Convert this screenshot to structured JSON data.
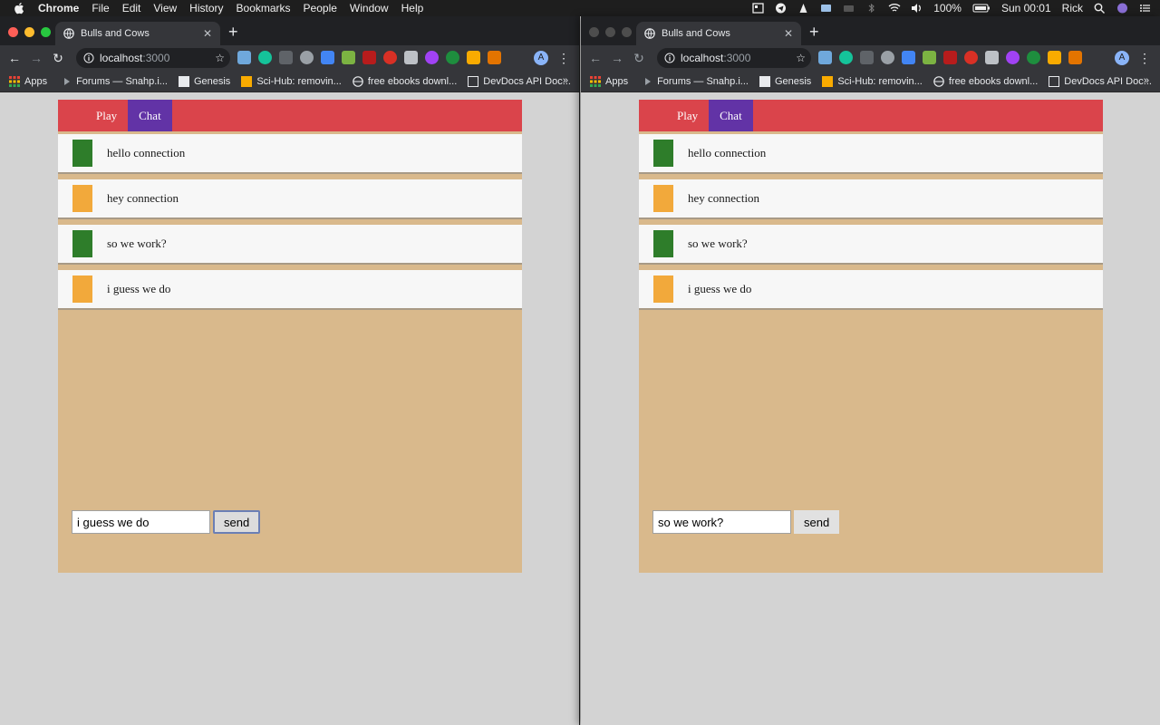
{
  "menubar": {
    "app_name": "Chrome",
    "items": [
      "File",
      "Edit",
      "View",
      "History",
      "Bookmarks",
      "People",
      "Window",
      "Help"
    ],
    "battery": "100%",
    "clock": "Sun 00:01",
    "user": "Rick"
  },
  "left": {
    "tab_title": "Bulls and Cows",
    "url_host": "localhost",
    "url_port": ":3000",
    "avatar_letter": "A",
    "bookmarks": {
      "apps": "Apps",
      "b1": "Forums — Snahp.i...",
      "b2": "Genesis",
      "b3": "Sci-Hub: removin...",
      "b4": "free ebooks downl...",
      "b5": "DevDocs API Doc..."
    },
    "nav": {
      "play": "Play",
      "chat": "Chat"
    },
    "messages": [
      {
        "text": "hello connection",
        "color": "#2e7d2a"
      },
      {
        "text": "hey connection",
        "color": "#f2a93b"
      },
      {
        "text": "so we work?",
        "color": "#2e7d2a"
      },
      {
        "text": "i guess we do",
        "color": "#f2a93b"
      }
    ],
    "input_value": "i guess we do",
    "send_label": "send"
  },
  "right": {
    "tab_title": "Bulls and Cows",
    "url_host": "localhost",
    "url_port": ":3000",
    "avatar_letter": "A",
    "bookmarks": {
      "apps": "Apps",
      "b1": "Forums — Snahp.i...",
      "b2": "Genesis",
      "b3": "Sci-Hub: removin...",
      "b4": "free ebooks downl...",
      "b5": "DevDocs API Doc..."
    },
    "nav": {
      "play": "Play",
      "chat": "Chat"
    },
    "messages": [
      {
        "text": "hello connection",
        "color": "#2e7d2a"
      },
      {
        "text": "hey connection",
        "color": "#f2a93b"
      },
      {
        "text": "so we work?",
        "color": "#2e7d2a"
      },
      {
        "text": "i guess we do",
        "color": "#f2a93b"
      }
    ],
    "input_value": "so we work?",
    "send_label": "send"
  },
  "colors": {
    "header_red": "#da444b",
    "active_tab_purple": "#6233a6",
    "chat_bg_tan": "#d9b98c",
    "green_player": "#2e7d2a",
    "orange_player": "#f2a93b"
  }
}
